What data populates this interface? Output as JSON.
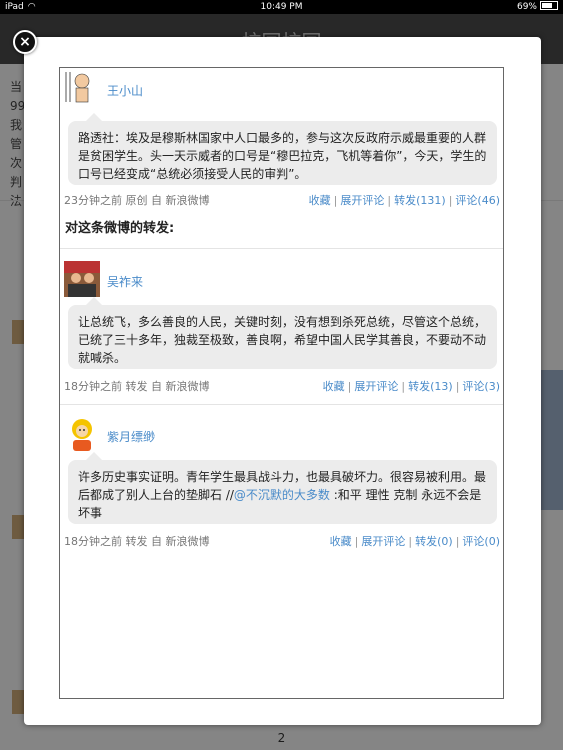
{
  "status_bar": {
    "carrier": "iPad",
    "time": "10:49 PM",
    "battery": "69%"
  },
  "background": {
    "title": "校园校园",
    "page_number": "2"
  },
  "original_post": {
    "username": "王小山",
    "text": "路透社：埃及是穆斯林国家中人口最多的，参与这次反政府示威最重要的人群是贫困学生。头一天示威者的口号是“穆巴拉克，飞机等着你”，今天，学生的口号已经变成“总统必须接受人民的审判”。",
    "time": "23分钟之前",
    "type": "原创",
    "source": "自 新浪微博",
    "favorite": "收藏",
    "expand_comments": "展开评论",
    "repost": "转发(131)",
    "comment": "评论(46)"
  },
  "reposts_title": "对这条微博的转发:",
  "reposts": [
    {
      "username": "吴祚来",
      "text": "让总统飞，多么善良的人民，关键时刻，没有想到杀死总统，尽管这个总统，已统了三十多年，独裁至极致，善良啊，希望中国人民学其善良，不要动不动就喊杀。",
      "time": "18分钟之前",
      "type": "转发",
      "source": "自 新浪微博",
      "favorite": "收藏",
      "expand_comments": "展开评论",
      "repost": "转发(13)",
      "comment": "评论(3)"
    },
    {
      "username": "紫月缥缈",
      "text_before": "许多历史事实证明。青年学生最具战斗力，也最具破坏力。很容易被利用。最后都成了别人上台的垫脚石 //",
      "mention": "@不沉默的大多数",
      "text_after": " :和平 理性 克制 永远不会是坏事",
      "time": "18分钟之前",
      "type": "转发",
      "source": "自 新浪微博",
      "favorite": "收藏",
      "expand_comments": "展开评论",
      "repost": "转发(0)",
      "comment": "评论(0)"
    }
  ],
  "icons": {
    "close": "close-icon",
    "share": "share-icon"
  }
}
